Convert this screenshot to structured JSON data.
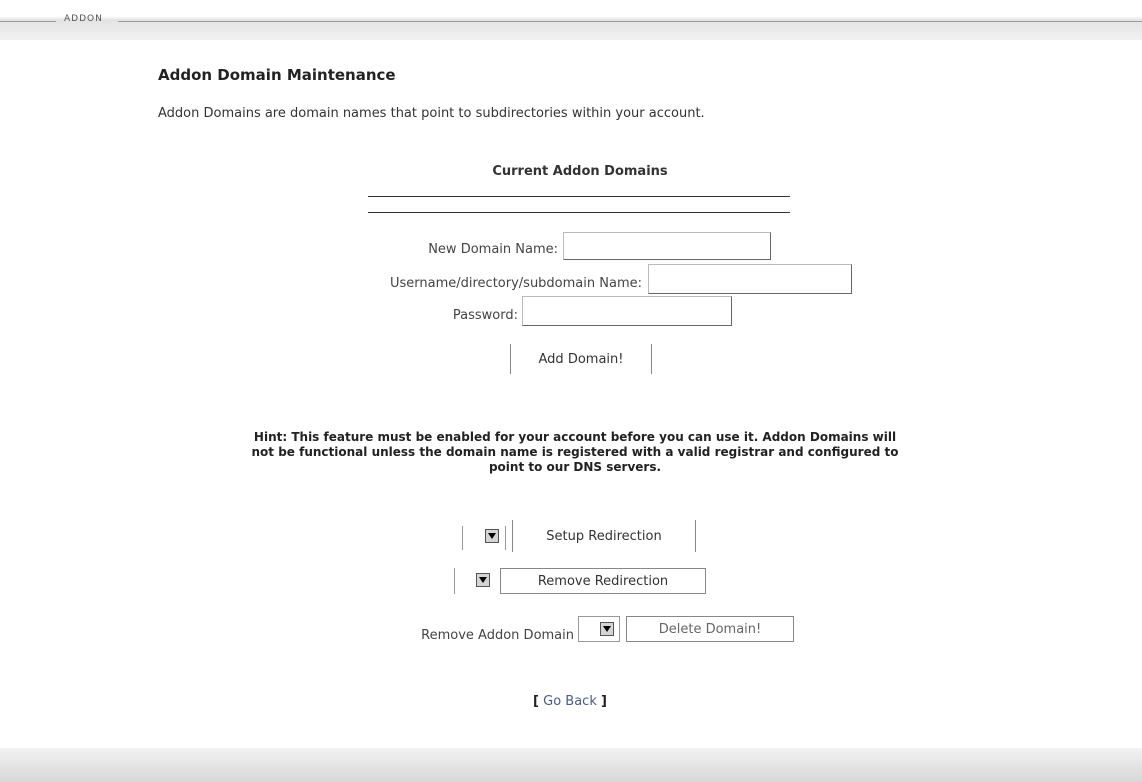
{
  "header": {
    "label": "ADDON"
  },
  "page": {
    "title": "Addon Domain Maintenance",
    "description": "Addon Domains are domain names that point to subdirectories within your account."
  },
  "current_domains": {
    "title": "Current Addon Domains"
  },
  "form": {
    "new_domain_label": "New Domain Name:",
    "new_domain_value": "",
    "username_label": "Username/directory/subdomain Name:",
    "username_value": "",
    "password_label": "Password:",
    "password_value": "",
    "add_button": "Add Domain!"
  },
  "hint": {
    "line1": "Hint: This feature must be enabled for your account before you can use it. Addon Domains will",
    "line2": "not be functional unless the domain name is registered with a valid registrar and configured to",
    "line3": "point to our DNS servers."
  },
  "redirection": {
    "setup_selected": "",
    "setup_button": "Setup Redirection",
    "remove_selected": "",
    "remove_button": "Remove Redirection"
  },
  "remove_domain": {
    "label": "Remove Addon Domain",
    "selected": "",
    "delete_button": "Delete Domain!"
  },
  "footer": {
    "back_open": "[",
    "back_link": "Go Back",
    "back_close": "]"
  },
  "icons": {
    "dropdown": "chevron-down-icon"
  }
}
